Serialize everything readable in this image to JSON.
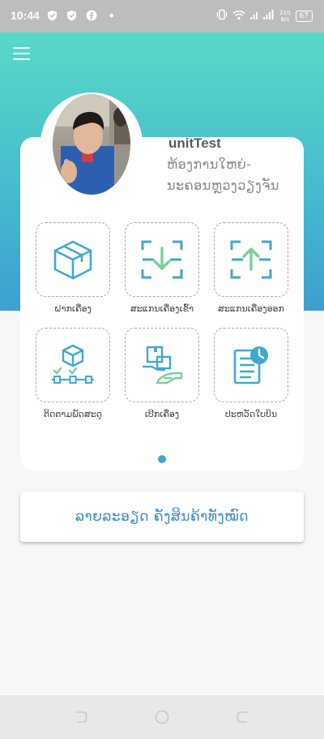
{
  "status_bar": {
    "time": "10:44",
    "network_speed_top": "210",
    "network_speed_bottom": "B/s",
    "battery": "67"
  },
  "profile": {
    "name": "unitTest",
    "organization": "ຫ້ອງການໃຫຍ່-ນະຄອນຫຼວງວຽງຈັນ"
  },
  "menu": {
    "items": [
      {
        "label": "ຝາກເຄື່ອງ",
        "icon": "box-icon"
      },
      {
        "label": "ສະແກນເຄື່ອງເຂົ້າ",
        "icon": "scan-in-icon"
      },
      {
        "label": "ສະແກນເຄື່ອງອອກ",
        "icon": "scan-out-icon"
      },
      {
        "label": "ຕິດຕາມພັດສະດຸ",
        "icon": "track-parcel-icon"
      },
      {
        "label": "ເບີກເຄື່ອງ",
        "icon": "withdraw-parcel-icon"
      },
      {
        "label": "ປະຫວັດໃບບິນ",
        "icon": "bill-history-icon"
      }
    ]
  },
  "detail_button": {
    "label": "ລາຍລະອຽດ ຄັງສິນຄ້າທັງໝົດ"
  },
  "colors": {
    "accent": "#3fa8cf",
    "gradient_top": "#58d9c7",
    "gradient_bottom": "#3c9fd2"
  }
}
